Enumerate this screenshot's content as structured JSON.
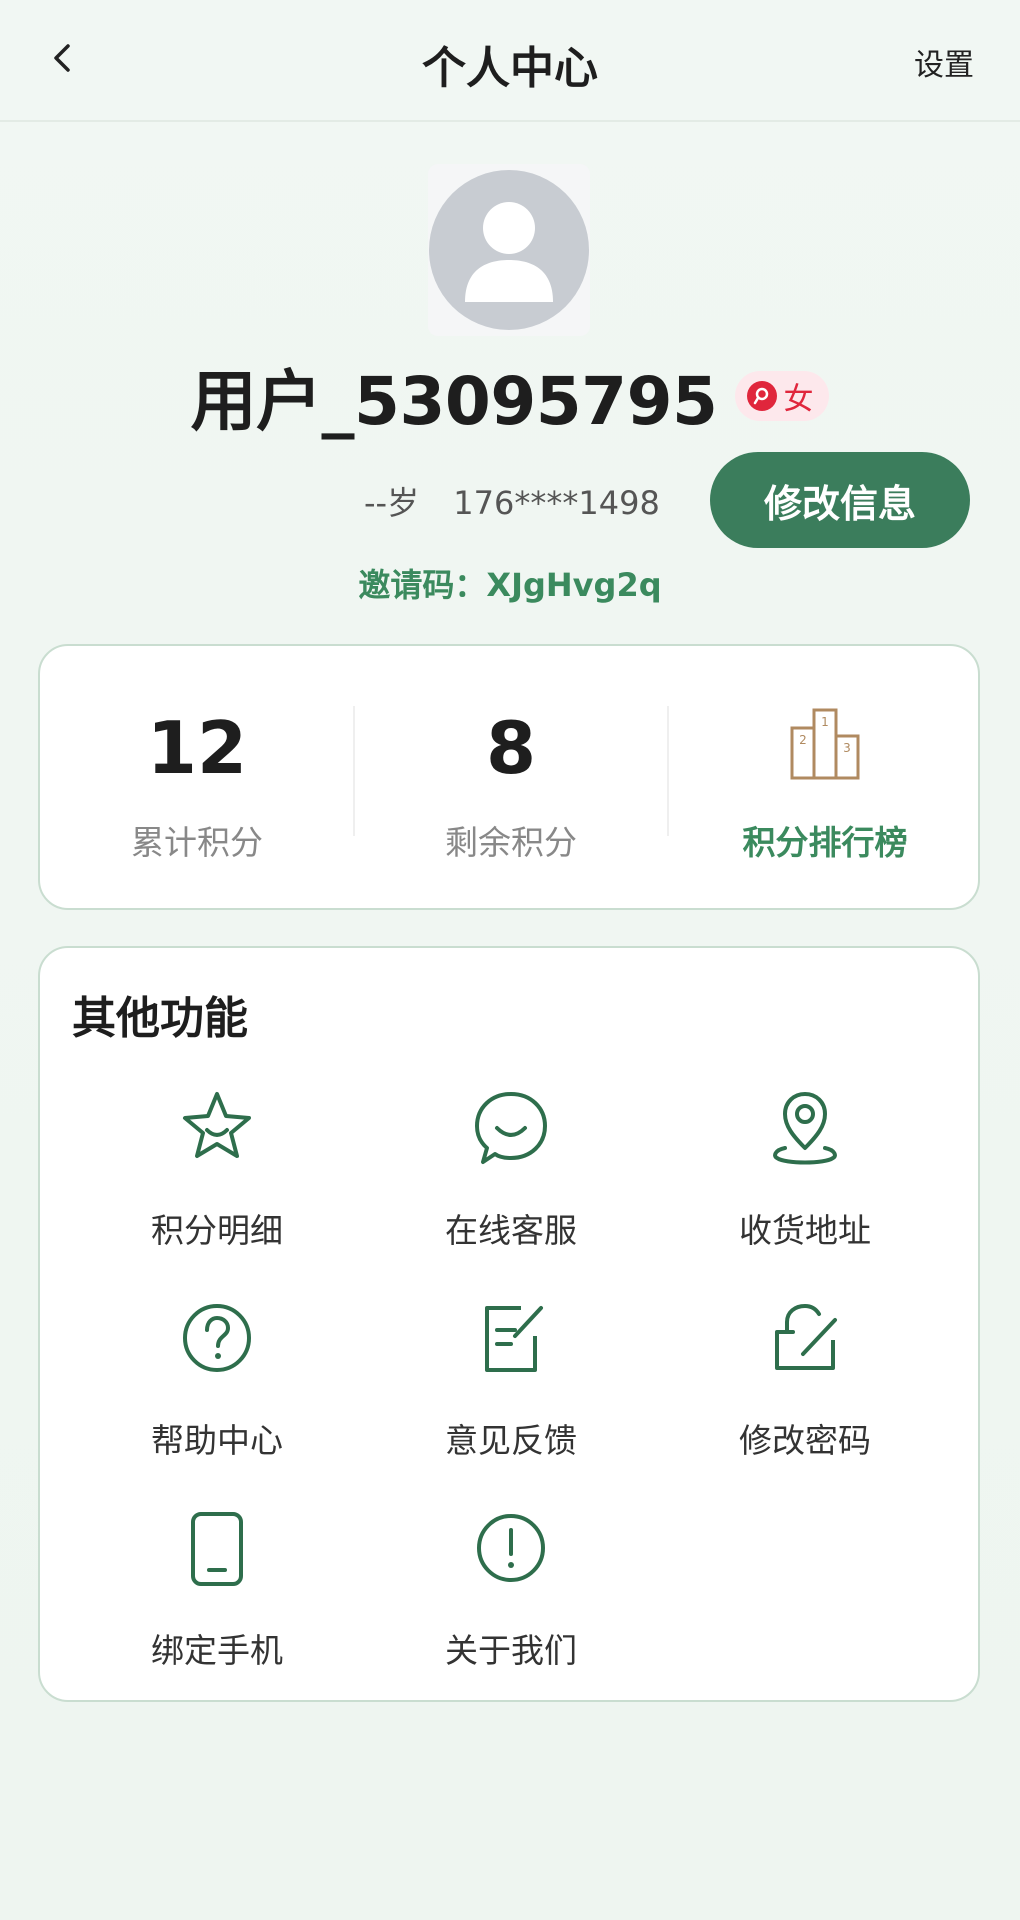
{
  "header": {
    "title": "个人中心",
    "settings_label": "设置",
    "back_icon": "chevron-left-icon"
  },
  "profile": {
    "username": "用户_53095795",
    "gender": "女",
    "age": "--岁",
    "phone": "176****1498",
    "edit_label": "修改信息",
    "invite_label": "邀请码：",
    "invite_code": "XJgHvg2q"
  },
  "stats": {
    "total_points": {
      "value": "12",
      "label": "累计积分"
    },
    "remaining_points": {
      "value": "8",
      "label": "剩余积分"
    },
    "leaderboard": {
      "label": "积分排行榜",
      "icon": "podium-icon"
    }
  },
  "features": {
    "title": "其他功能",
    "items": [
      {
        "label": "积分明细",
        "icon": "star-icon"
      },
      {
        "label": "在线客服",
        "icon": "chat-icon"
      },
      {
        "label": "收货地址",
        "icon": "location-icon"
      },
      {
        "label": "帮助中心",
        "icon": "help-icon"
      },
      {
        "label": "意见反馈",
        "icon": "feedback-icon"
      },
      {
        "label": "修改密码",
        "icon": "lock-icon"
      },
      {
        "label": "绑定手机",
        "icon": "phone-icon"
      },
      {
        "label": "关于我们",
        "icon": "info-icon"
      }
    ]
  },
  "colors": {
    "accent": "#3b7d5c",
    "accent_text": "#3b8a5e",
    "gender": "#e0263c",
    "rank_icon": "#b08a60"
  }
}
